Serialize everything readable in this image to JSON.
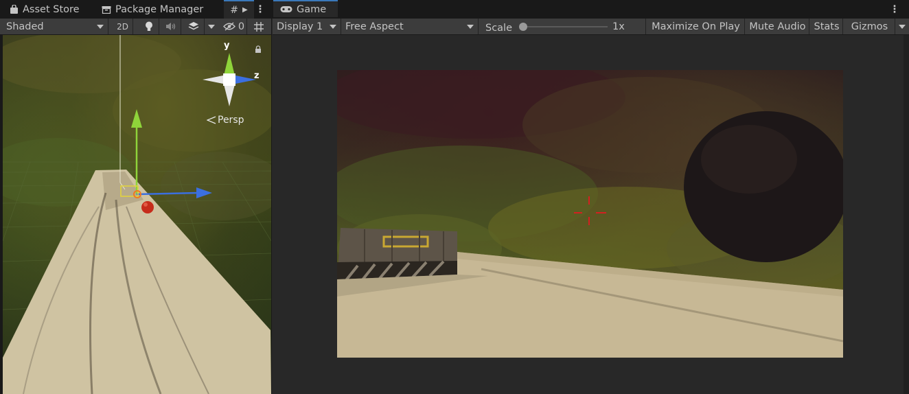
{
  "tabs_left": {
    "asset_store": "Asset Store",
    "package_manager": "Package Manager"
  },
  "tabs_right": {
    "game": "Game"
  },
  "scene_toolbar": {
    "shading_mode": "Shaded",
    "toggle_2d": "2D",
    "hidden_count": "0"
  },
  "scene_view": {
    "axis_y": "y",
    "axis_z": "z",
    "projection": "Persp"
  },
  "game_toolbar": {
    "display": "Display 1",
    "aspect": "Free Aspect",
    "scale_label": "Scale",
    "scale_value": "1x",
    "maximize": "Maximize On Play",
    "mute": "Mute Audio",
    "stats": "Stats",
    "gizmos": "Gizmos"
  },
  "colors": {
    "accent_tab": "#3a79bb",
    "axis_y": "#8fd43a",
    "axis_z": "#3b6fe0",
    "crosshair": "#d42020"
  }
}
